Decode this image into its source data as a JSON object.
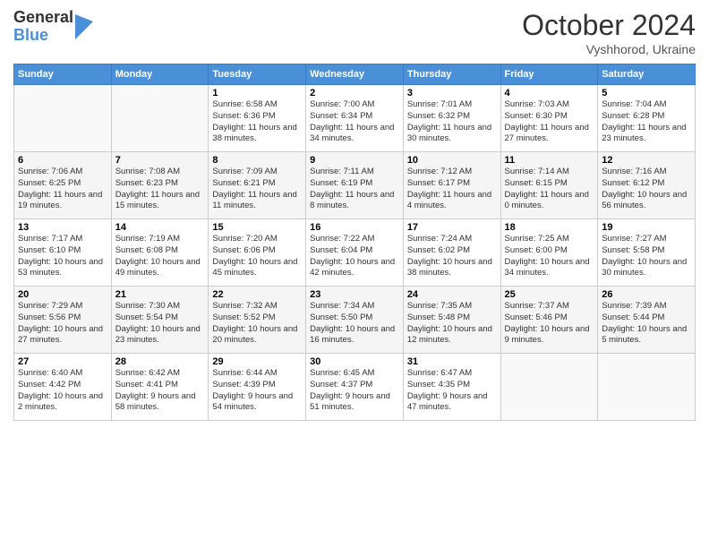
{
  "header": {
    "logo_general": "General",
    "logo_blue": "Blue",
    "month": "October 2024",
    "location": "Vyshhorod, Ukraine"
  },
  "weekdays": [
    "Sunday",
    "Monday",
    "Tuesday",
    "Wednesday",
    "Thursday",
    "Friday",
    "Saturday"
  ],
  "weeks": [
    [
      {
        "day": "",
        "sunrise": "",
        "sunset": "",
        "daylight": ""
      },
      {
        "day": "",
        "sunrise": "",
        "sunset": "",
        "daylight": ""
      },
      {
        "day": "1",
        "sunrise": "Sunrise: 6:58 AM",
        "sunset": "Sunset: 6:36 PM",
        "daylight": "Daylight: 11 hours and 38 minutes."
      },
      {
        "day": "2",
        "sunrise": "Sunrise: 7:00 AM",
        "sunset": "Sunset: 6:34 PM",
        "daylight": "Daylight: 11 hours and 34 minutes."
      },
      {
        "day": "3",
        "sunrise": "Sunrise: 7:01 AM",
        "sunset": "Sunset: 6:32 PM",
        "daylight": "Daylight: 11 hours and 30 minutes."
      },
      {
        "day": "4",
        "sunrise": "Sunrise: 7:03 AM",
        "sunset": "Sunset: 6:30 PM",
        "daylight": "Daylight: 11 hours and 27 minutes."
      },
      {
        "day": "5",
        "sunrise": "Sunrise: 7:04 AM",
        "sunset": "Sunset: 6:28 PM",
        "daylight": "Daylight: 11 hours and 23 minutes."
      }
    ],
    [
      {
        "day": "6",
        "sunrise": "Sunrise: 7:06 AM",
        "sunset": "Sunset: 6:25 PM",
        "daylight": "Daylight: 11 hours and 19 minutes."
      },
      {
        "day": "7",
        "sunrise": "Sunrise: 7:08 AM",
        "sunset": "Sunset: 6:23 PM",
        "daylight": "Daylight: 11 hours and 15 minutes."
      },
      {
        "day": "8",
        "sunrise": "Sunrise: 7:09 AM",
        "sunset": "Sunset: 6:21 PM",
        "daylight": "Daylight: 11 hours and 11 minutes."
      },
      {
        "day": "9",
        "sunrise": "Sunrise: 7:11 AM",
        "sunset": "Sunset: 6:19 PM",
        "daylight": "Daylight: 11 hours and 8 minutes."
      },
      {
        "day": "10",
        "sunrise": "Sunrise: 7:12 AM",
        "sunset": "Sunset: 6:17 PM",
        "daylight": "Daylight: 11 hours and 4 minutes."
      },
      {
        "day": "11",
        "sunrise": "Sunrise: 7:14 AM",
        "sunset": "Sunset: 6:15 PM",
        "daylight": "Daylight: 11 hours and 0 minutes."
      },
      {
        "day": "12",
        "sunrise": "Sunrise: 7:16 AM",
        "sunset": "Sunset: 6:12 PM",
        "daylight": "Daylight: 10 hours and 56 minutes."
      }
    ],
    [
      {
        "day": "13",
        "sunrise": "Sunrise: 7:17 AM",
        "sunset": "Sunset: 6:10 PM",
        "daylight": "Daylight: 10 hours and 53 minutes."
      },
      {
        "day": "14",
        "sunrise": "Sunrise: 7:19 AM",
        "sunset": "Sunset: 6:08 PM",
        "daylight": "Daylight: 10 hours and 49 minutes."
      },
      {
        "day": "15",
        "sunrise": "Sunrise: 7:20 AM",
        "sunset": "Sunset: 6:06 PM",
        "daylight": "Daylight: 10 hours and 45 minutes."
      },
      {
        "day": "16",
        "sunrise": "Sunrise: 7:22 AM",
        "sunset": "Sunset: 6:04 PM",
        "daylight": "Daylight: 10 hours and 42 minutes."
      },
      {
        "day": "17",
        "sunrise": "Sunrise: 7:24 AM",
        "sunset": "Sunset: 6:02 PM",
        "daylight": "Daylight: 10 hours and 38 minutes."
      },
      {
        "day": "18",
        "sunrise": "Sunrise: 7:25 AM",
        "sunset": "Sunset: 6:00 PM",
        "daylight": "Daylight: 10 hours and 34 minutes."
      },
      {
        "day": "19",
        "sunrise": "Sunrise: 7:27 AM",
        "sunset": "Sunset: 5:58 PM",
        "daylight": "Daylight: 10 hours and 30 minutes."
      }
    ],
    [
      {
        "day": "20",
        "sunrise": "Sunrise: 7:29 AM",
        "sunset": "Sunset: 5:56 PM",
        "daylight": "Daylight: 10 hours and 27 minutes."
      },
      {
        "day": "21",
        "sunrise": "Sunrise: 7:30 AM",
        "sunset": "Sunset: 5:54 PM",
        "daylight": "Daylight: 10 hours and 23 minutes."
      },
      {
        "day": "22",
        "sunrise": "Sunrise: 7:32 AM",
        "sunset": "Sunset: 5:52 PM",
        "daylight": "Daylight: 10 hours and 20 minutes."
      },
      {
        "day": "23",
        "sunrise": "Sunrise: 7:34 AM",
        "sunset": "Sunset: 5:50 PM",
        "daylight": "Daylight: 10 hours and 16 minutes."
      },
      {
        "day": "24",
        "sunrise": "Sunrise: 7:35 AM",
        "sunset": "Sunset: 5:48 PM",
        "daylight": "Daylight: 10 hours and 12 minutes."
      },
      {
        "day": "25",
        "sunrise": "Sunrise: 7:37 AM",
        "sunset": "Sunset: 5:46 PM",
        "daylight": "Daylight: 10 hours and 9 minutes."
      },
      {
        "day": "26",
        "sunrise": "Sunrise: 7:39 AM",
        "sunset": "Sunset: 5:44 PM",
        "daylight": "Daylight: 10 hours and 5 minutes."
      }
    ],
    [
      {
        "day": "27",
        "sunrise": "Sunrise: 6:40 AM",
        "sunset": "Sunset: 4:42 PM",
        "daylight": "Daylight: 10 hours and 2 minutes."
      },
      {
        "day": "28",
        "sunrise": "Sunrise: 6:42 AM",
        "sunset": "Sunset: 4:41 PM",
        "daylight": "Daylight: 9 hours and 58 minutes."
      },
      {
        "day": "29",
        "sunrise": "Sunrise: 6:44 AM",
        "sunset": "Sunset: 4:39 PM",
        "daylight": "Daylight: 9 hours and 54 minutes."
      },
      {
        "day": "30",
        "sunrise": "Sunrise: 6:45 AM",
        "sunset": "Sunset: 4:37 PM",
        "daylight": "Daylight: 9 hours and 51 minutes."
      },
      {
        "day": "31",
        "sunrise": "Sunrise: 6:47 AM",
        "sunset": "Sunset: 4:35 PM",
        "daylight": "Daylight: 9 hours and 47 minutes."
      },
      {
        "day": "",
        "sunrise": "",
        "sunset": "",
        "daylight": ""
      },
      {
        "day": "",
        "sunrise": "",
        "sunset": "",
        "daylight": ""
      }
    ]
  ]
}
